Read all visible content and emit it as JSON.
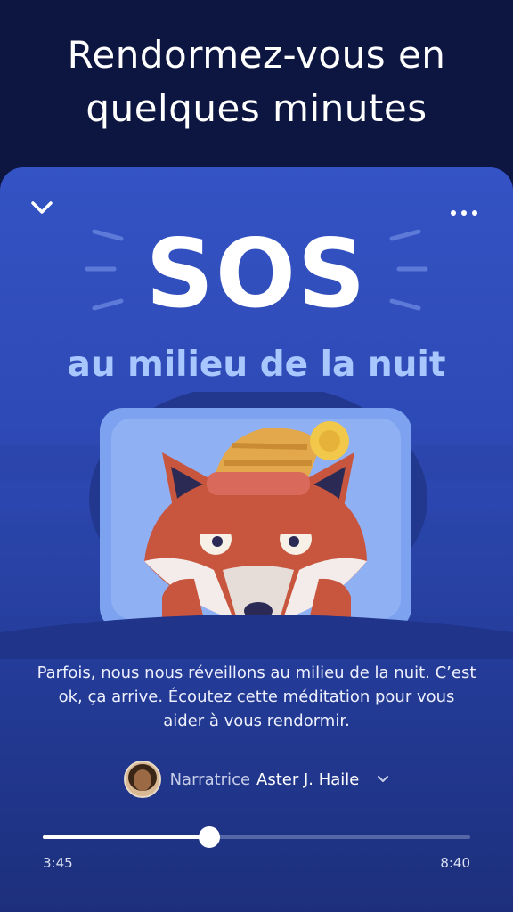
{
  "headline": "Rendormez-vous en\nquelques minutes",
  "card": {
    "title": "SOS",
    "subtitle": "au milieu de la nuit",
    "description": "Parfois, nous nous réveillons au milieu de la nuit. C’est ok, ça arrive. Écoutez cette méditation pour vous aider à vous rendormir."
  },
  "narrator": {
    "prefix": "Narratrice",
    "name": "Aster J. Haile"
  },
  "player": {
    "elapsed": "3:45",
    "total": "8:40",
    "progress": 0.39
  },
  "icons": {
    "collapse": "chevron-down-icon",
    "more": "more-dots-icon",
    "expand": "chevron-down-icon"
  },
  "colors": {
    "background": "#0d1640",
    "card": "#3453c4",
    "subtitle": "#a9c7ff",
    "fox": "#c8553d"
  }
}
